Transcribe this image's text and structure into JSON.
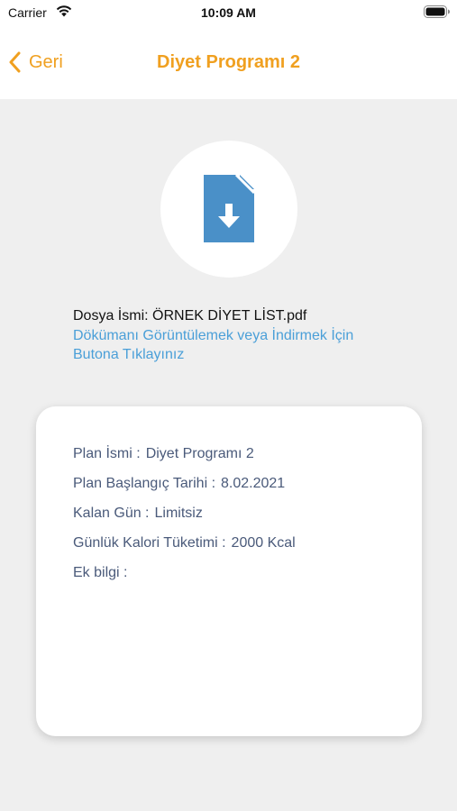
{
  "status_bar": {
    "carrier": "Carrier",
    "time": "10:09 AM"
  },
  "nav": {
    "back_label": "Geri",
    "title": "Diyet Programı 2"
  },
  "document": {
    "icon": "file-download-icon",
    "file_name": "Dosya İsmi: ÖRNEK DİYET LİST.pdf",
    "link_text": "Dökümanı Görüntülemek veya İndirmek İçin Butona Tıklayınız"
  },
  "plan": {
    "name_label": "Plan İsmi :",
    "name_value": "Diyet Programı 2",
    "start_label": "Plan Başlangıç Tarihi :",
    "start_value": "8.02.2021",
    "days_label": "Kalan Gün :",
    "days_value": "Limitsiz",
    "calorie_label": "Günlük Kalori Tüketimi :",
    "calorie_value": "2000 Kcal",
    "extra_label": "Ek bilgi :",
    "extra_value": ""
  },
  "colors": {
    "accent": "#f0a020",
    "link": "#4a9fd8",
    "icon": "#4a90c8",
    "label_text": "#4a5a7a",
    "background": "#efefef"
  }
}
